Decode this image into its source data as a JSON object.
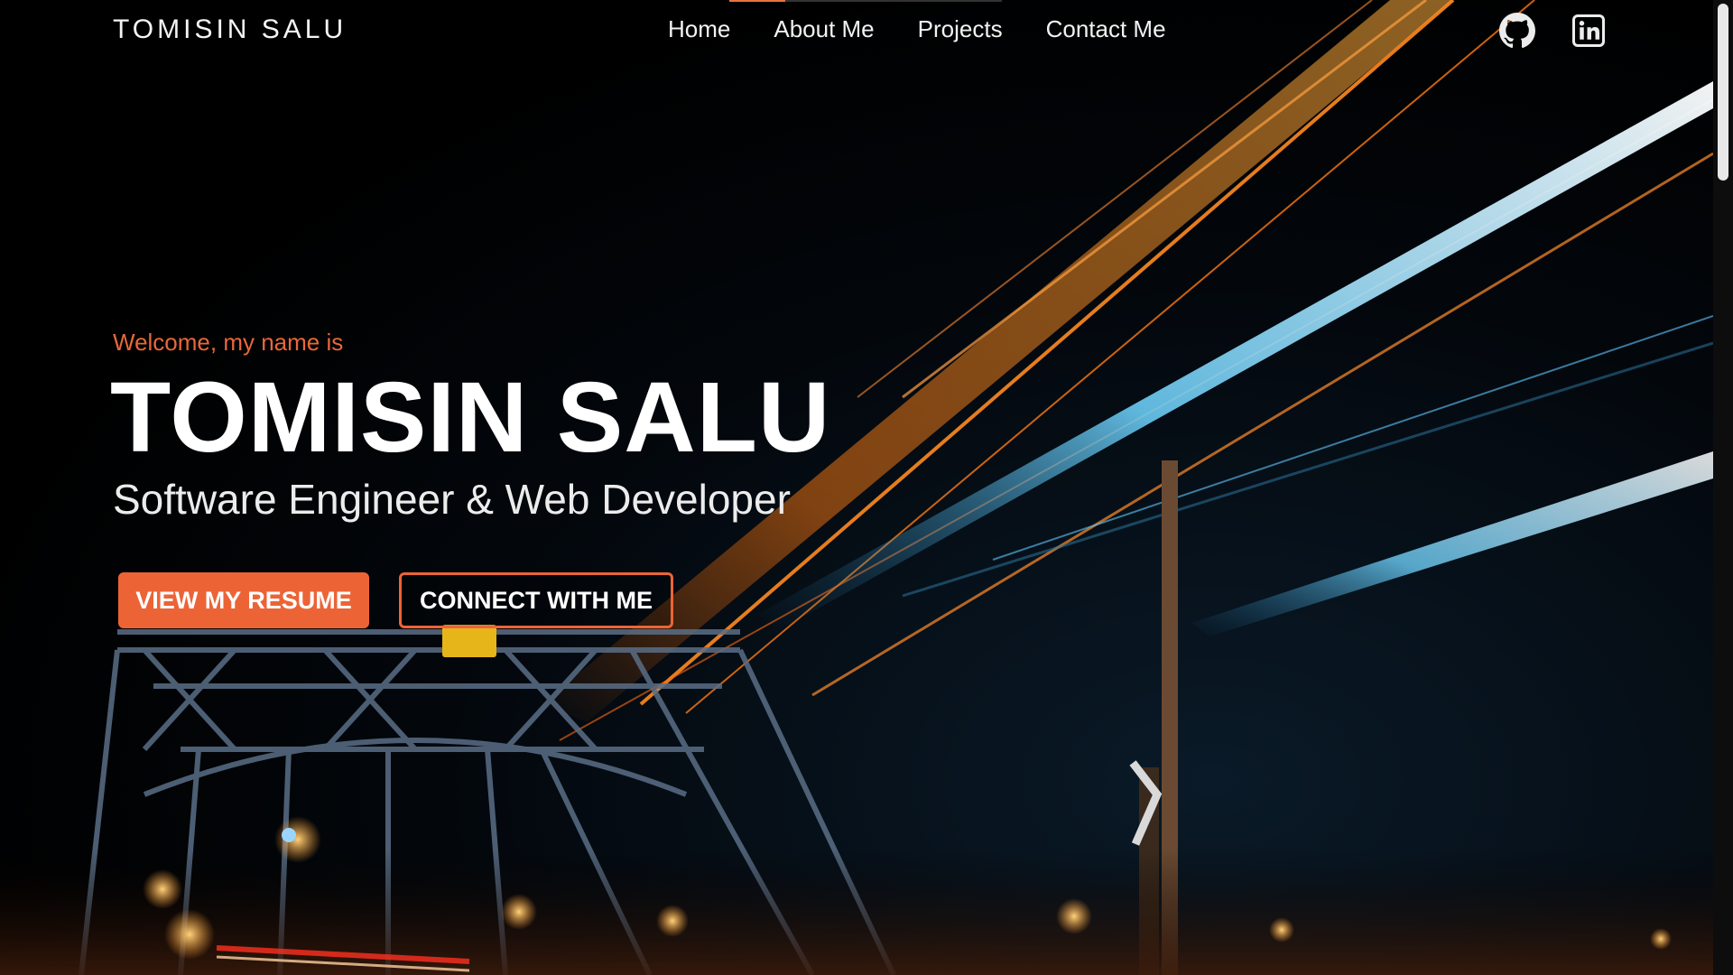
{
  "header": {
    "brand": "TOMISIN SALU",
    "nav": [
      {
        "label": "Home"
      },
      {
        "label": "About Me"
      },
      {
        "label": "Projects"
      },
      {
        "label": "Contact Me"
      }
    ],
    "social": [
      {
        "icon": "github-icon"
      },
      {
        "icon": "linkedin-icon"
      }
    ]
  },
  "hero": {
    "welcome": "Welcome, my name is",
    "name": "TOMISIN SALU",
    "role": "Software Engineer & Web Developer",
    "primary_button": "VIEW MY RESUME",
    "secondary_button": "CONNECT WITH ME"
  },
  "colors": {
    "accent": "#ec6436",
    "text": "#ffffff",
    "background": "#000000"
  }
}
